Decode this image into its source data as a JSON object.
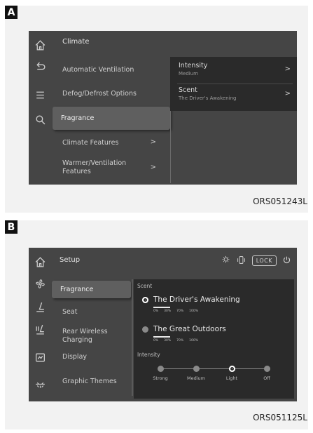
{
  "panelA": {
    "badge": "A",
    "caption": "ORS051243L",
    "title": "Climate",
    "menu": [
      {
        "label": "Automatic Ventilation",
        "chevron": ""
      },
      {
        "label": "Defog/Defrost Options",
        "chevron": ""
      },
      {
        "label": "Fragrance",
        "chevron": "",
        "selected": true
      },
      {
        "label": "Climate Features",
        "chevron": ">"
      },
      {
        "label": "Warmer/Ventilation Features",
        "chevron": ">"
      }
    ],
    "flyout": [
      {
        "label": "Intensity",
        "value": "Medium",
        "chevron": ">"
      },
      {
        "label": "Scent",
        "value": "The Driver's Awakening",
        "chevron": ">"
      }
    ],
    "rail_icons": [
      "home-icon",
      "back-icon",
      "menu-icon",
      "search-icon"
    ]
  },
  "panelB": {
    "badge": "B",
    "caption": "ORS051125L",
    "title": "Setup",
    "lock_label": "LOCK",
    "menu": [
      {
        "label": "Fragrance",
        "selected": true
      },
      {
        "label": "Seat"
      },
      {
        "label": "Rear Wireless Charging"
      },
      {
        "label": "Display"
      },
      {
        "label": "Graphic Themes"
      }
    ],
    "scent_label": "Scent",
    "scents": [
      {
        "name": "The Driver's Awakening",
        "selected": true,
        "levels": [
          "0%",
          "30%",
          "70%",
          "100%"
        ]
      },
      {
        "name": "The Great Outdoors",
        "selected": false,
        "levels": [
          "0%",
          "30%",
          "70%",
          "100%"
        ]
      }
    ],
    "intensity_label": "Intensity",
    "intensity_options": [
      "Strong",
      "Medium",
      "Light",
      "Off"
    ],
    "intensity_selected": "Light",
    "rail_icons": [
      "home-icon",
      "fan-icon",
      "seat-icon",
      "seat-heat-icon",
      "display-icon",
      "theme-icon"
    ],
    "status_icons": [
      "brightness-icon",
      "phone-vibrate-icon",
      "lock-icon",
      "power-icon"
    ]
  },
  "colors": {
    "screen_bg": "#454545",
    "panel_bg": "#2a2a2a",
    "selected_bg": "#5f5f5f",
    "text": "#e8e8e8"
  }
}
